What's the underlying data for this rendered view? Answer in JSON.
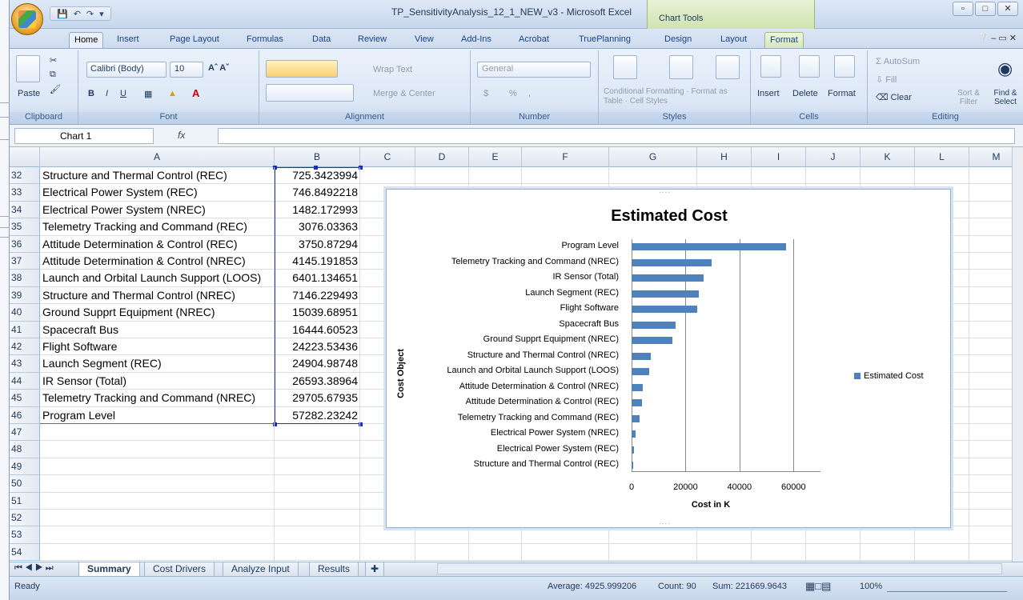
{
  "window": {
    "title": "TP_SensitivityAnalysis_12_1_NEW_v3 - Microsoft Excel",
    "context_tab": "Chart Tools"
  },
  "tabs": [
    "Home",
    "Insert",
    "Page Layout",
    "Formulas",
    "Data",
    "Review",
    "View",
    "Add-Ins",
    "Acrobat",
    "TruePlanning",
    "Design",
    "Layout",
    "Format"
  ],
  "ribbon": {
    "clipboard": {
      "paste": "Paste",
      "label": "Clipboard"
    },
    "font": {
      "name": "Calibri (Body)",
      "size": "10",
      "label": "Font"
    },
    "alignment": {
      "wrap": "Wrap Text",
      "merge": "Merge & Center",
      "label": "Alignment"
    },
    "number": {
      "format": "General",
      "dollar": "$",
      "percent": "%",
      "comma": ",",
      "label": "Number"
    },
    "styles": {
      "cond": "Conditional Formatting",
      "table": "Format as Table",
      "cell": "Cell Styles",
      "label": "Styles"
    },
    "cells": {
      "insert": "Insert",
      "delete": "Delete",
      "format": "Format",
      "label": "Cells"
    },
    "editing": {
      "autosum": "AutoSum",
      "fill": "Fill",
      "clear": "Clear",
      "sort": "Sort & Filter",
      "find": "Find & Select",
      "label": "Editing"
    }
  },
  "formula_bar": {
    "name_box": "Chart 1",
    "fx": "fx",
    "value": ""
  },
  "columns": [
    "A",
    "B",
    "C",
    "D",
    "E",
    "F",
    "G",
    "H",
    "I",
    "J",
    "K",
    "L",
    "M"
  ],
  "rows": [
    {
      "n": "32",
      "a": "Structure and Thermal Control (REC)",
      "b": "725.3423994"
    },
    {
      "n": "33",
      "a": "Electrical Power System  (REC)",
      "b": "746.8492218"
    },
    {
      "n": "34",
      "a": "Electrical Power System  (NREC)",
      "b": "1482.172993"
    },
    {
      "n": "35",
      "a": "Telemetry Tracking and Command (REC)",
      "b": "3076.03363"
    },
    {
      "n": "36",
      "a": "Attitude Determination & Control  (REC)",
      "b": "3750.87294"
    },
    {
      "n": "37",
      "a": "Attitude Determination & Control  (NREC)",
      "b": "4145.191853"
    },
    {
      "n": "38",
      "a": "Launch and Orbital Launch Support (LOOS)",
      "b": "6401.134651"
    },
    {
      "n": "39",
      "a": "Structure and Thermal Control (NREC)",
      "b": "7146.229493"
    },
    {
      "n": "40",
      "a": "Ground Supprt Equipment (NREC)",
      "b": "15039.68951"
    },
    {
      "n": "41",
      "a": "Spacecraft Bus",
      "b": "16444.60523"
    },
    {
      "n": "42",
      "a": "Flight Software",
      "b": "24223.53436"
    },
    {
      "n": "43",
      "a": "Launch Segment (REC)",
      "b": "24904.98748"
    },
    {
      "n": "44",
      "a": "IR Sensor (Total)",
      "b": "26593.38964"
    },
    {
      "n": "45",
      "a": "Telemetry Tracking and Command (NREC)",
      "b": "29705.67935"
    },
    {
      "n": "46",
      "a": "Program Level",
      "b": "57282.23242"
    },
    {
      "n": "47",
      "a": "",
      "b": ""
    },
    {
      "n": "48",
      "a": "",
      "b": ""
    },
    {
      "n": "49",
      "a": "",
      "b": ""
    },
    {
      "n": "50",
      "a": "",
      "b": ""
    },
    {
      "n": "51",
      "a": "",
      "b": ""
    },
    {
      "n": "52",
      "a": "",
      "b": ""
    },
    {
      "n": "53",
      "a": "",
      "b": ""
    },
    {
      "n": "54",
      "a": "",
      "b": ""
    }
  ],
  "chart_data": {
    "type": "bar",
    "title": "Estimated Cost",
    "xlabel": "Cost in K",
    "ylabel": "Cost Object",
    "xlim": [
      0,
      70000
    ],
    "xticks": [
      "0",
      "20000",
      "40000",
      "60000"
    ],
    "legend": "right",
    "categories": [
      "Program Level",
      "Telemetry Tracking and Command  (NREC)",
      "IR Sensor (Total)",
      "Launch Segment (REC)",
      "Flight Software",
      "Spacecraft Bus",
      "Ground Supprt Equipment  (NREC)",
      "Structure and Thermal Control (NREC)",
      "Launch and Orbital Launch Support (LOOS)",
      "Attitude Determination & Control  (NREC)",
      "Attitude Determination & Control  (REC)",
      "Telemetry Tracking and Command  (REC)",
      "Electrical Power System  (NREC)",
      "Electrical Power System  (REC)",
      "Structure and Thermal Control (REC)"
    ],
    "series": [
      {
        "name": "Estimated Cost",
        "values": [
          57282.23,
          29705.68,
          26593.39,
          24904.99,
          24223.53,
          16444.61,
          15039.69,
          7146.23,
          6401.13,
          4145.19,
          3750.87,
          3076.03,
          1482.17,
          746.85,
          725.34
        ]
      }
    ],
    "color": "#4f81bd"
  },
  "sheet_tabs": [
    "Summary",
    "Cost Drivers",
    "Analyze Input",
    "Results"
  ],
  "status": {
    "ready": "Ready",
    "average": "Average: 4925.999206",
    "count": "Count: 90",
    "sum": "Sum: 221669.9643",
    "zoom": "100%"
  }
}
